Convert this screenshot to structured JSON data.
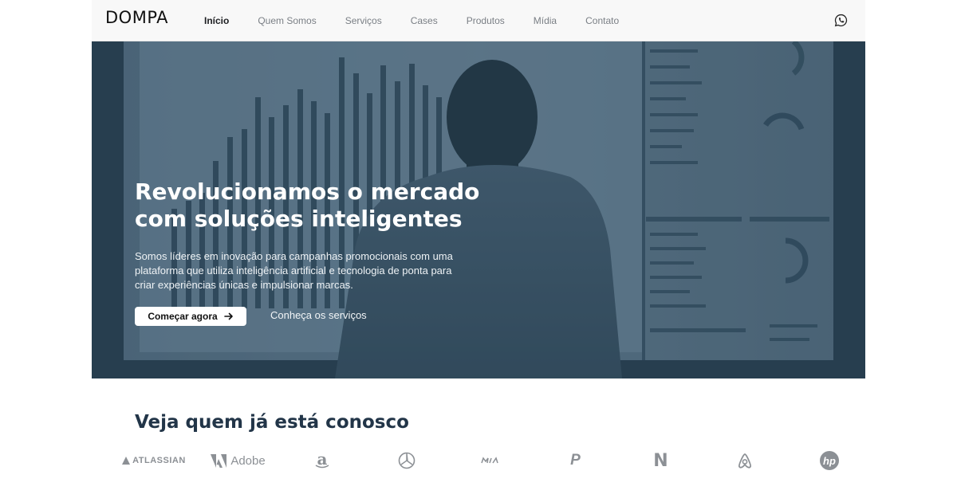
{
  "brand": {
    "logo_text": "DOMPA"
  },
  "nav": {
    "items": [
      {
        "label": "Início",
        "active": true
      },
      {
        "label": "Quem Somos"
      },
      {
        "label": "Serviços"
      },
      {
        "label": "Cases"
      },
      {
        "label": "Produtos"
      },
      {
        "label": "Mídia"
      },
      {
        "label": "Contato"
      }
    ],
    "whatsapp_icon": "whatsapp-icon"
  },
  "hero": {
    "title": "Revolucionamos o mercado com soluções inteligentes",
    "description": "Somos líderes em inovação para campanhas promocionais com uma plataforma que utiliza inteligência artificial e tecnologia de ponta para criar experiências únicas e impulsionar marcas.",
    "cta_primary": "Começar agora",
    "cta_primary_icon": "arrow-right-icon",
    "cta_secondary": "Conheça os serviços"
  },
  "partners": {
    "title": "Veja quem já está conosco",
    "logos": [
      {
        "name": "atlassian-logo",
        "text": "ATLASSIAN"
      },
      {
        "name": "adobe-logo",
        "text": "Adobe"
      },
      {
        "name": "amazon-logo",
        "text": "a"
      },
      {
        "name": "mercedes-logo",
        "text": ""
      },
      {
        "name": "kia-logo",
        "text": "KIA"
      },
      {
        "name": "paypal-logo",
        "text": "P"
      },
      {
        "name": "netflix-logo",
        "text": "N"
      },
      {
        "name": "airbnb-logo",
        "text": ""
      },
      {
        "name": "hp-logo",
        "text": "hp"
      }
    ]
  },
  "colors": {
    "heading": "#223548",
    "hero_overlay": "#2d4455",
    "logo_gray": "#8c9095"
  }
}
